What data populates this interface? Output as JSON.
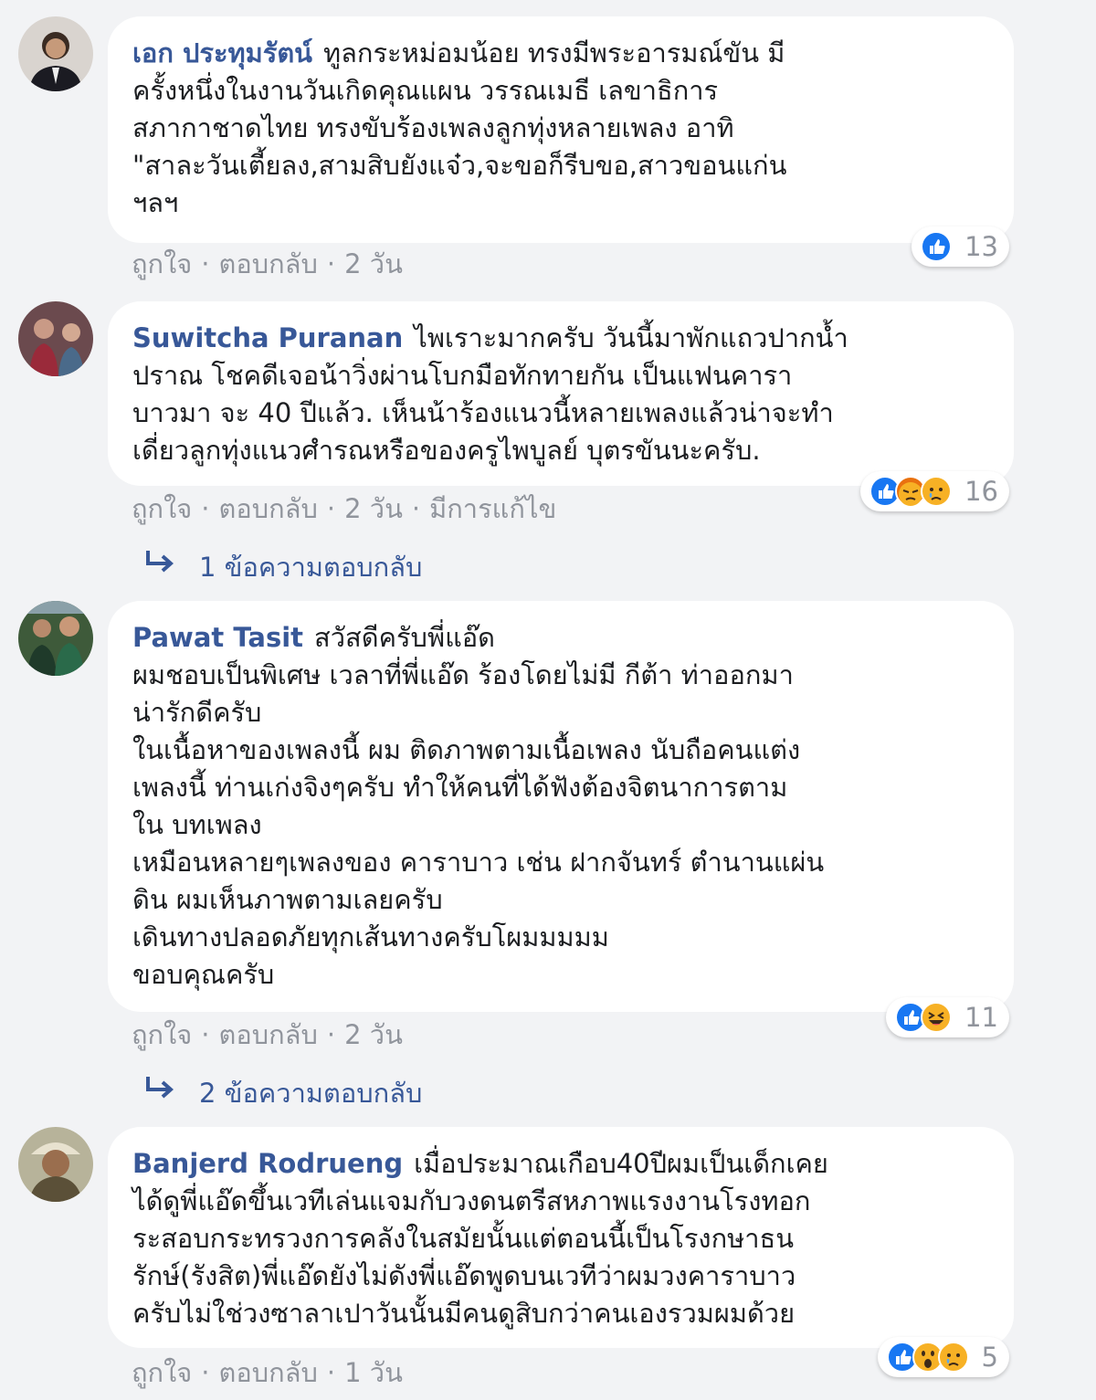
{
  "comments": [
    {
      "author": "เอก ประทุมรัตน์",
      "lines": [
        "ทูลกระหม่อมน้อย ทรงมีพระอารมณ์ขัน มี",
        "ครั้งหนึ่งในงานวันเกิดคุณแผน วรรณเมธี เลขาธิการ",
        "สภากาชาดไทย ทรงขับร้องเพลงลูกทุ่งหลายเพลง อาทิ",
        "\"สาละวันเตี้ยลง,สามสิบยังแจ๋ว,จะขอก็รีบขอ,สาวขอนแก่น",
        "ฯลฯ"
      ],
      "like": "ถูกใจ",
      "reply": "ตอบกลับ",
      "time": "2 วัน",
      "edited": "",
      "reaction_icons": [
        "like-icon"
      ],
      "reaction_count": "13",
      "replies_text": ""
    },
    {
      "author": "Suwitcha Puranan",
      "lines": [
        "ไพเราะมากครับ วันนี้มาพักแถวปากน้ำ",
        "ปราณ โชคดีเจอน้าวิ่งผ่านโบกมือทักทายกัน เป็นแฟนคารา",
        "บาวมา จะ 40 ปีแล้ว. เห็นน้าร้องแนวนี้หลายเพลงแล้วน่าจะทำ",
        "เดี่ยวลูกทุ่งแนวศํารณหรือของครูไพบูลย์ บุตรขันนะครับ."
      ],
      "like": "ถูกใจ",
      "reply": "ตอบกลับ",
      "time": "2 วัน",
      "edited": "มีการแก้ไข",
      "reaction_icons": [
        "like-icon",
        "angry-icon",
        "sad-icon"
      ],
      "reaction_count": "16",
      "replies_text": "1 ข้อความตอบกลับ"
    },
    {
      "author": "Pawat Tasit",
      "lines": [
        "สวัสดีครับพี่แอ๊ด",
        "ผมชอบเป็นพิเศษ เวลาที่พี่แอ๊ด ร้องโดยไม่มี กีต้า ท่าออกมา",
        "น่ารักดีครับ",
        "ในเนื้อหาของเพลงนี้ ผม ติดภาพตามเนื้อเพลง นับถือคนแต่ง",
        "เพลงนี้ ท่านเก่งจิงๆครับ ทำให้คนที่ได้ฟังต้องจิตนาการตาม",
        "ใน บทเพลง",
        "เหมือนหลายๆเพลงของ คาราบาว เช่น ฝากจันทร์ ตำนานแผ่น",
        "ดิน ผมเห็นภาพตามเลยครับ",
        "เดินทางปลอดภัยทุกเส้นทางครับโผมมมมม",
        "ขอบคุณครับ"
      ],
      "like": "ถูกใจ",
      "reply": "ตอบกลับ",
      "time": "2 วัน",
      "edited": "",
      "reaction_icons": [
        "like-icon",
        "haha-icon"
      ],
      "reaction_count": "11",
      "replies_text": "2 ข้อความตอบกลับ"
    },
    {
      "author": "Banjerd Rodrueng",
      "lines": [
        "เมื่อประมาณเกือบ40ปีผมเป็นเด็กเคย",
        "ได้ดูพี่แอ๊ดขึ้นเวทีเล่นแจมกับวงดนตรีสหภาพแรงงานโรงทอก",
        "ระสอบกระทรวงการคลังในสมัยนั้นแต่ตอนนี้เป็นโรงกษาธน",
        "รักษ์(รังสิต)พี่แอ๊ดยังไม่ดังพี่แอ๊ดพูดบนเวทีว่าผมวงคาราบาว",
        "ครับไม่ใช่วงซาลาเปาวันนั้นมีคนดูสิบกว่าคนเองรวมผมด้วย"
      ],
      "like": "ถูกใจ",
      "reply": "ตอบกลับ",
      "time": "1 วัน",
      "edited": "",
      "reaction_icons": [
        "like-icon",
        "wow-icon",
        "sad-icon"
      ],
      "reaction_count": "5",
      "replies_text": ""
    }
  ],
  "colors": {
    "background": "#f2f3f5",
    "bubble": "#ffffff",
    "author": "#385898",
    "meta": "#90949c",
    "like_blue": "#1877f2"
  }
}
